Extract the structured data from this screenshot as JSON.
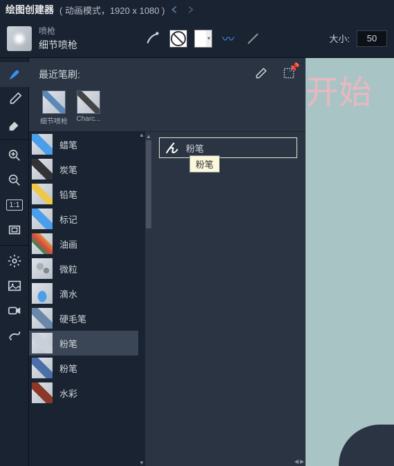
{
  "title": {
    "main": "绘图创建器",
    "sub": "( 动画模式，1920 x 1080 )"
  },
  "tool": {
    "cat": "喷枪",
    "name": "细节喷枪"
  },
  "size": {
    "label": "大小:",
    "value": "50"
  },
  "recent": {
    "header": "最近笔刷:",
    "items": [
      {
        "label": "细节喷枪"
      },
      {
        "label": "Charc..."
      }
    ]
  },
  "categories": [
    {
      "label": "蜡笔",
      "ic": "ic-crayon"
    },
    {
      "label": "炭笔",
      "ic": "ic-charcoal"
    },
    {
      "label": "铅笔",
      "ic": "ic-pencil"
    },
    {
      "label": "标记",
      "ic": "ic-marker"
    },
    {
      "label": "油画",
      "ic": "ic-oil"
    },
    {
      "label": "微粒",
      "ic": "ic-particle"
    },
    {
      "label": "滴水",
      "ic": "ic-drip"
    },
    {
      "label": "硬毛笔",
      "ic": "ic-bristle"
    },
    {
      "label": "粉笔",
      "ic": "ic-chalk",
      "sel": true
    },
    {
      "label": "粉笔",
      "ic": "ic-chalk2"
    },
    {
      "label": "水彩",
      "ic": "ic-water"
    }
  ],
  "sub": {
    "item": "粉笔",
    "tooltip": "粉笔"
  },
  "canvas": {
    "text": "开始"
  }
}
